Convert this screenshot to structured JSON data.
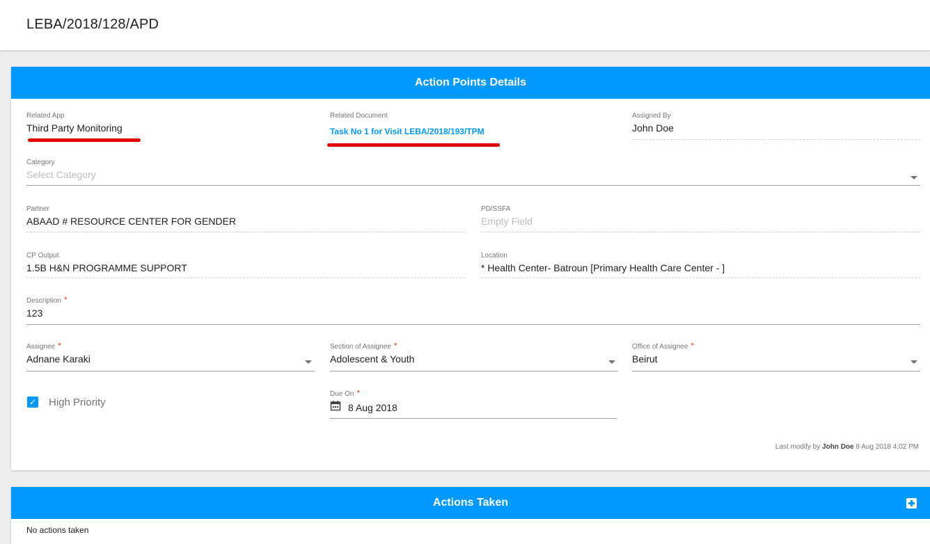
{
  "page": {
    "title": "LEBA/2018/128/APD"
  },
  "details": {
    "header": "Action Points Details",
    "related_app": {
      "label": "Related App",
      "value": "Third Party Monitoring"
    },
    "related_document": {
      "label": "Related Document",
      "value": "Task No 1 for Visit LEBA/2018/193/TPM"
    },
    "assigned_by": {
      "label": "Assigned By",
      "value": "John Doe"
    },
    "category": {
      "label": "Category",
      "placeholder": "Select Category"
    },
    "partner": {
      "label": "Partner",
      "value": "ABAAD # RESOURCE CENTER FOR GENDER"
    },
    "pd_ssfa": {
      "label": "PD/SSFA",
      "placeholder": "Empty Field"
    },
    "cp_output": {
      "label": "CP Output",
      "value": "1.5B H&N PROGRAMME SUPPORT"
    },
    "location": {
      "label": "Location",
      "value": "* Health Center- Batroun [Primary Health Care Center - ]"
    },
    "description": {
      "label": "Description",
      "required": "*",
      "value": "123"
    },
    "assignee": {
      "label": "Assignee",
      "required": "*",
      "value": "Adnane Karaki"
    },
    "section": {
      "label": "Section of Assignee",
      "required": "*",
      "value": "Adolescent & Youth"
    },
    "office": {
      "label": "Office of Assignee",
      "required": "*",
      "value": "Beirut"
    },
    "high_priority": {
      "label": "High Priority",
      "checked": true
    },
    "due_on": {
      "label": "Due On",
      "required": "*",
      "value": "8 Aug 2018"
    },
    "last_modify": {
      "prefix": "Last modify by",
      "user": "John Doe",
      "timestamp": "8 Aug 2018 4:02 PM"
    }
  },
  "actions": {
    "header": "Actions Taken",
    "empty_text": "No actions taken"
  },
  "colors": {
    "primary": "#0099ff",
    "annotation": "#e00000",
    "required": "#ea4022"
  },
  "icons": {
    "dropdown": "chevron-down-icon",
    "calendar": "calendar-icon",
    "add": "plus-icon",
    "check": "check-icon"
  }
}
